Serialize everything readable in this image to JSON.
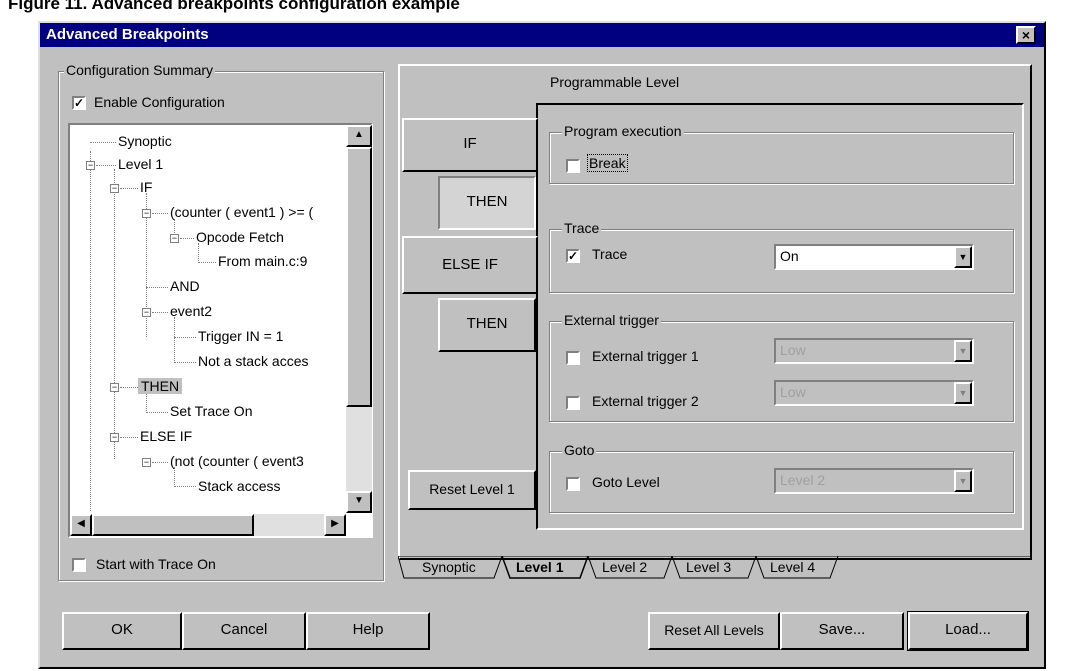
{
  "page_heading": "Figure 11. Advanced breakpoints configuration example",
  "window": {
    "title": "Advanced Breakpoints",
    "close_label": "×"
  },
  "summary": {
    "group_label": "Configuration Summary",
    "enable_label": "Enable Configuration",
    "enable_checked": true,
    "tree": [
      "Synoptic",
      "Level 1",
      "IF",
      "(counter ( event1 ) >= (",
      "Opcode Fetch",
      "From main.c:9",
      "AND",
      "event2",
      "Trigger IN = 1",
      "Not a stack acces",
      "THEN",
      "Set Trace On",
      "ELSE IF",
      "(not (counter ( event3",
      "Stack access"
    ],
    "start_trace_label": "Start with Trace On",
    "start_trace_checked": false
  },
  "prog": {
    "label": "Programmable Level",
    "blocks": {
      "if": "IF",
      "then1": "THEN",
      "elseif": "ELSE IF",
      "then2": "THEN"
    },
    "reset_level": "Reset Level 1",
    "program_execution": {
      "label": "Program execution",
      "break_label": "Break",
      "checked": false
    },
    "trace": {
      "label": "Trace",
      "check_label": "Trace",
      "checked": true,
      "value": "On"
    },
    "external": {
      "label": "External trigger",
      "t1": {
        "label": "External trigger 1",
        "value": "Low",
        "checked": false
      },
      "t2": {
        "label": "External trigger 2",
        "value": "Low",
        "checked": false
      }
    },
    "goto": {
      "label": "Goto",
      "check_label": "Goto Level",
      "value": "Level 2",
      "checked": false
    }
  },
  "tabs": [
    "Synoptic",
    "Level 1",
    "Level 2",
    "Level 3",
    "Level 4"
  ],
  "active_tab": "Level 1",
  "buttons": {
    "ok": "OK",
    "cancel": "Cancel",
    "help": "Help",
    "reset_all": "Reset All Levels",
    "save": "Save...",
    "load": "Load..."
  },
  "icons": {
    "checkbox_checked": "check-icon",
    "dropdown": "chevron-down-icon"
  }
}
